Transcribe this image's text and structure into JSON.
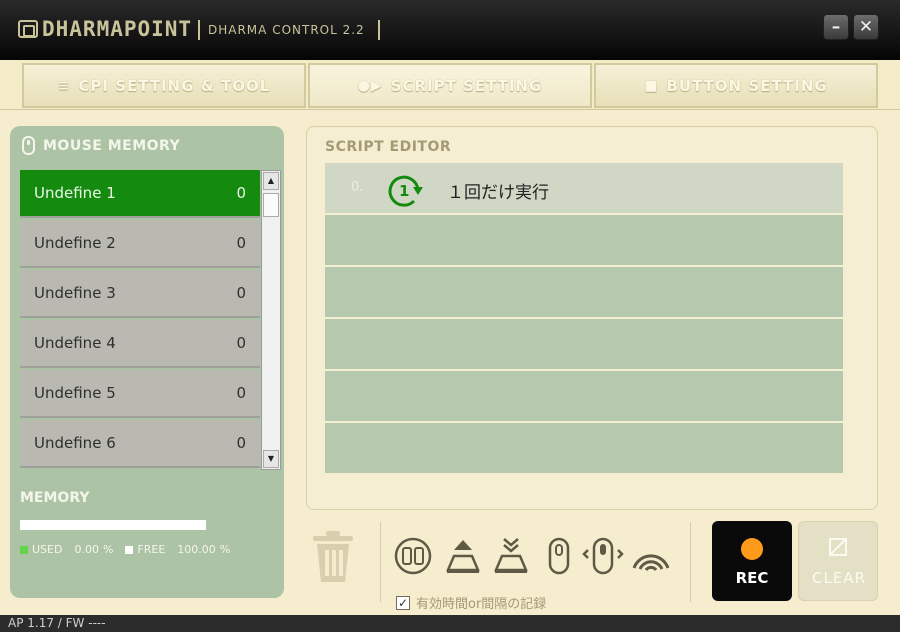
{
  "window": {
    "brand": "DHARMAPOINT",
    "title": "DHARMA CONTROL 2.2",
    "minimize_label": "–",
    "close_label": "✕"
  },
  "tabs": [
    {
      "icon": "≡",
      "label": "CPI SETTING & TOOL",
      "active": false
    },
    {
      "icon": "●▶",
      "label": "SCRIPT SETTING",
      "active": true
    },
    {
      "icon": "■",
      "label": "BUTTON SETTING",
      "active": false
    }
  ],
  "mouse_memory": {
    "title": "MOUSE MEMORY",
    "items": [
      {
        "label": "Undefine 1",
        "count": "0",
        "selected": true
      },
      {
        "label": "Undefine 2",
        "count": "0"
      },
      {
        "label": "Undefine 3",
        "count": "0"
      },
      {
        "label": "Undefine 4",
        "count": "0"
      },
      {
        "label": "Undefine 5",
        "count": "0"
      },
      {
        "label": "Undefine 6",
        "count": "0"
      }
    ]
  },
  "memory": {
    "title": "MEMORY",
    "used_label": "USED",
    "used_value": "0.00",
    "free_label": "FREE",
    "free_value": "100.00",
    "unit": "%"
  },
  "script_editor": {
    "title": "SCRIPT EDITOR",
    "rows": [
      {
        "index": "0.",
        "icon": "loop-once-icon",
        "text": "１回だけ実行"
      },
      {
        "index": "",
        "text": ""
      },
      {
        "index": "",
        "text": ""
      },
      {
        "index": "",
        "text": ""
      },
      {
        "index": "",
        "text": ""
      },
      {
        "index": "",
        "text": ""
      }
    ]
  },
  "toolbar": {
    "checkbox_label": "有効時間or間隔の記録",
    "checkbox_checked": true,
    "rec_label": "REC",
    "clear_label": "CLEAR"
  },
  "status": {
    "text": "AP 1.17 / FW ----"
  },
  "colors": {
    "selected_item": "#148a0e",
    "rec_dot": "#ff9a1a",
    "panel": "#adc3a6",
    "background": "#f5edcd"
  }
}
